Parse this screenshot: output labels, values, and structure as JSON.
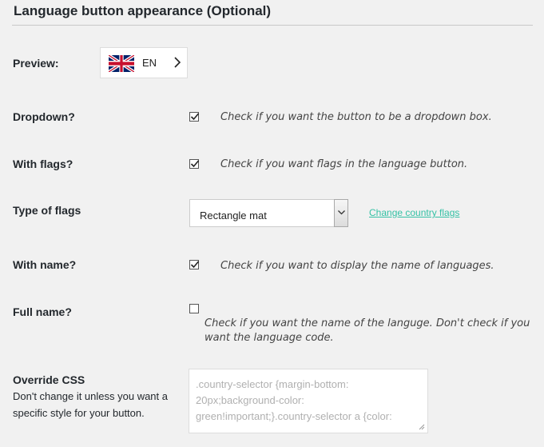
{
  "section": {
    "title": "Language button appearance (Optional)"
  },
  "preview": {
    "label": "Preview:",
    "lang_code": "EN"
  },
  "dropdown": {
    "label": "Dropdown?",
    "help": "Check if you want the button to be a dropdown box.",
    "checked": true
  },
  "with_flags": {
    "label": "With flags?",
    "help": "Check if you want flags in the language button.",
    "checked": true
  },
  "type_of_flags": {
    "label": "Type of flags",
    "selected": "Rectangle mat",
    "link": "Change country flags"
  },
  "with_name": {
    "label": "With name?",
    "help": "Check if you want to display the name of languages.",
    "checked": true
  },
  "full_name": {
    "label": "Full name?",
    "help_line1": "Check if you want the name of the languge. Don't check if you",
    "help_line2": "want the language code.",
    "checked": false
  },
  "override_css": {
    "label": "Override CSS",
    "description_line1": "Don't change it unless you want a",
    "description_line2": "specific style for your button.",
    "placeholder_line1": ".country-selector {margin-bottom:",
    "placeholder_line2": "20px;background-color:",
    "placeholder_line3": "green!important;}.country-selector a {color:"
  },
  "colors": {
    "link": "#35c1a5",
    "background": "#f1f1f1"
  }
}
